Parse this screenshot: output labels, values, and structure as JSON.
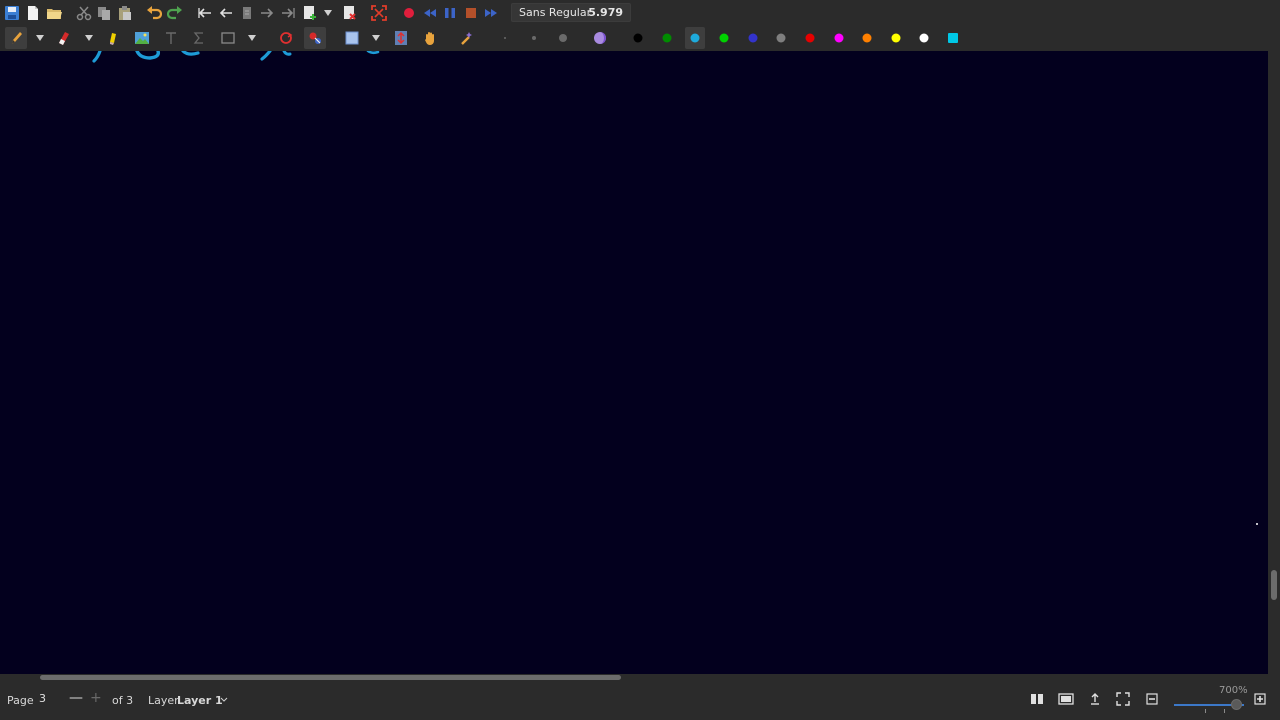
{
  "toolbar_top": {
    "font_name": "Sans Regular",
    "font_size": "5.979"
  },
  "colors": {
    "accent": "#3c78c8",
    "canvas_bg": "#03001e",
    "stroke": "#1e9bd7",
    "palette": [
      "#000000",
      "#008c00",
      "#1eaadc",
      "#00d200",
      "#3333cc",
      "#7f7f7f",
      "#e60000",
      "#ff00ff",
      "#ff8000",
      "#ffff00",
      "#ffffff",
      "#00c8e6"
    ]
  },
  "statusbar": {
    "page_label": "Page",
    "page_value": "3",
    "of_label": "of 3",
    "layer_label": "Layer",
    "layer_value": "Layer 1",
    "zoom_text": "700%"
  }
}
